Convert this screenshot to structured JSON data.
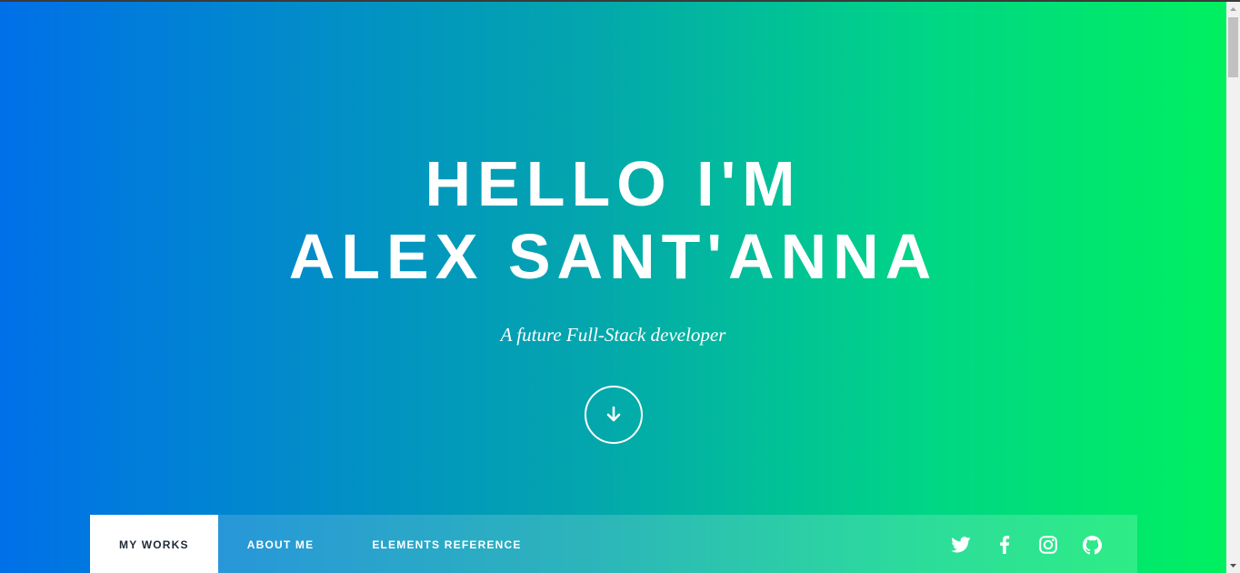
{
  "hero": {
    "title_line1": "HELLO I'M",
    "title_line2": "ALEX SANT'ANNA",
    "subtitle": "A future Full-Stack developer",
    "scroll_down_icon": "arrow-down-icon"
  },
  "nav": {
    "items": [
      {
        "label": "MY WORKS",
        "active": true
      },
      {
        "label": "ABOUT ME",
        "active": false
      },
      {
        "label": "ELEMENTS REFERENCE",
        "active": false
      }
    ],
    "social": [
      "twitter-icon",
      "facebook-icon",
      "instagram-icon",
      "github-icon"
    ]
  },
  "colors": {
    "gradient_start": "#0070e8",
    "gradient_end": "#00f060",
    "active_tab_bg": "#ffffff",
    "active_tab_text": "#1f2a36"
  }
}
